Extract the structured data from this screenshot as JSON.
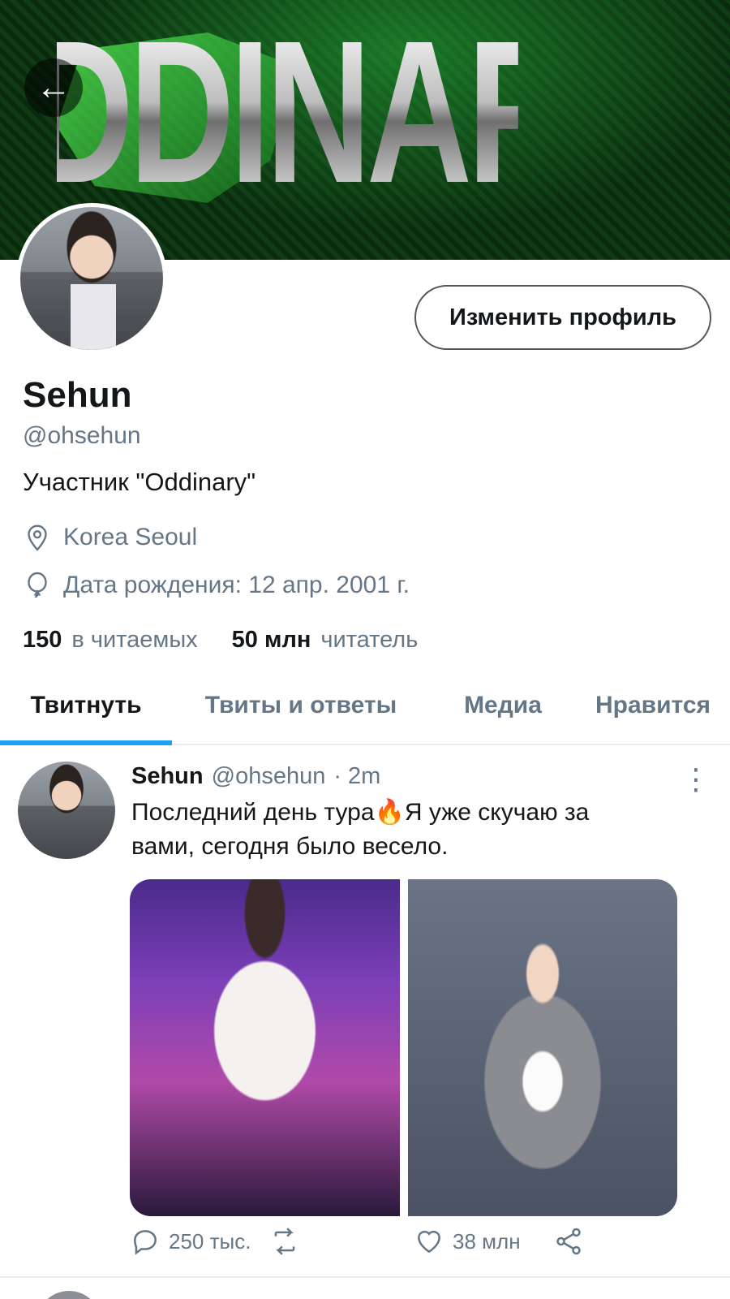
{
  "banner": {
    "word": "ODDINARY"
  },
  "header": {
    "back_icon": "arrow-left-icon"
  },
  "profile": {
    "edit_label": "Изменить профиль",
    "name": "Sehun",
    "handle": "@ohsehun",
    "bio": "Участник \"Oddinary\"",
    "location": "Korea Seoul",
    "birthday": "Дата рождения: 12 апр. 2001 г.",
    "following_count": "150",
    "following_label": "в читаемых",
    "followers_count": "50 млн",
    "followers_label": "читатель"
  },
  "tabs": [
    "Твитнуть",
    "Твиты и ответы",
    "Медиа",
    "Нравится"
  ],
  "tweet": {
    "name": "Sehun",
    "handle": "@ohsehun",
    "time": "· 2m",
    "text": "Последний день тура🔥Я уже скучаю за вами, сегодня было весело.",
    "replies": "250 тыс.",
    "retweets": "",
    "likes": "38 млн"
  },
  "colors": {
    "accent": "#1da1f2",
    "secondary_text": "#657786"
  }
}
